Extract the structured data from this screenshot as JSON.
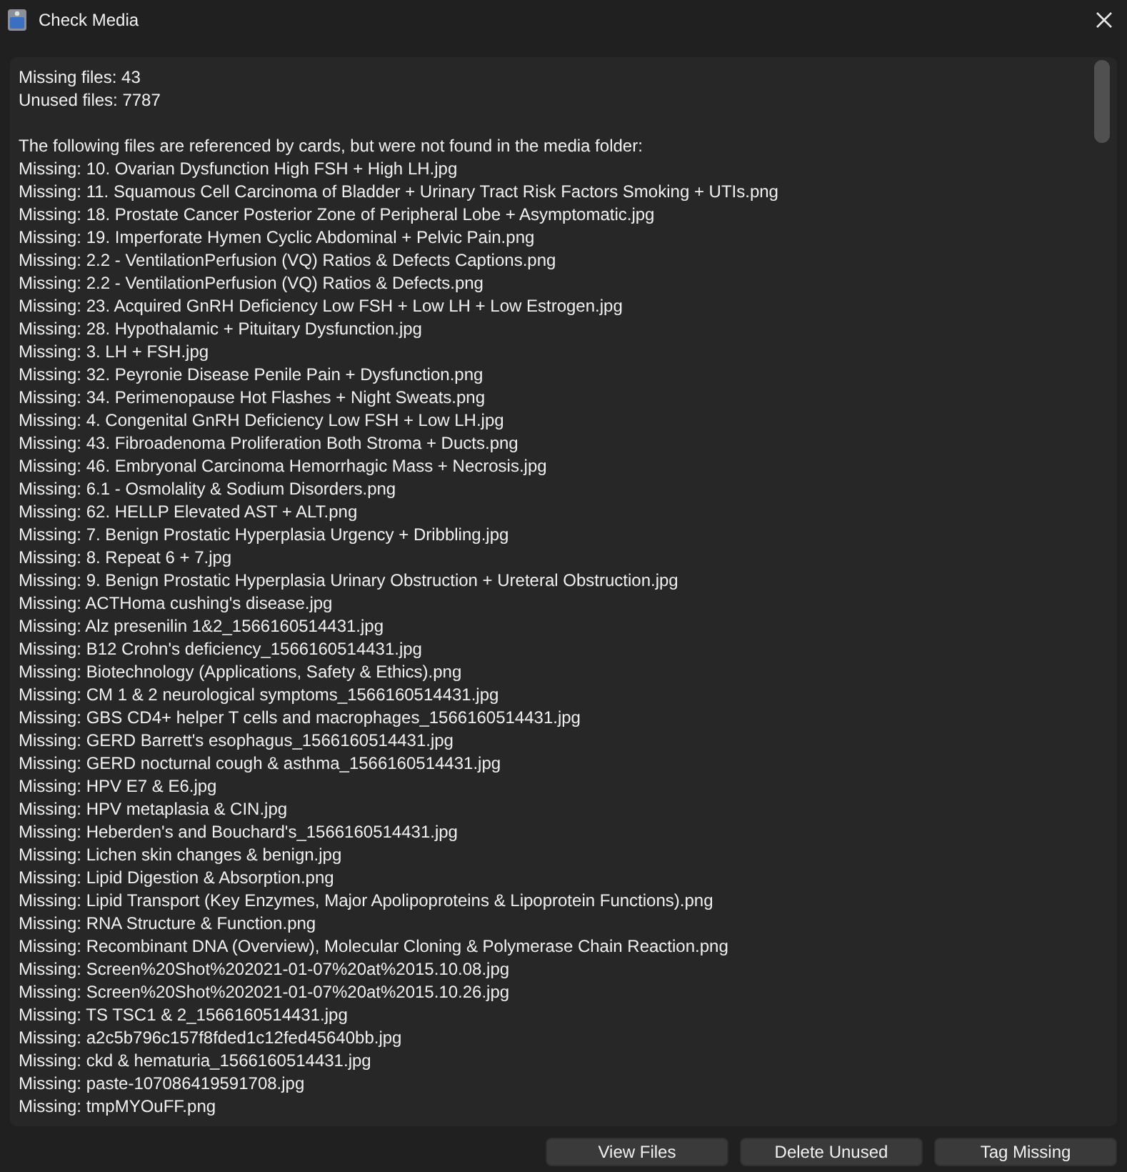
{
  "window": {
    "title": "Check Media"
  },
  "report": {
    "summary": [
      "Missing files: 43",
      "Unused files: 7787"
    ],
    "heading": "The following files are referenced by cards, but were not found in the media folder:",
    "missing": [
      "Missing: 10. Ovarian Dysfunction High FSH + High LH.jpg",
      "Missing: 11. Squamous Cell Carcinoma of Bladder + Urinary Tract Risk Factors Smoking + UTIs.png",
      "Missing: 18. Prostate Cancer Posterior Zone of Peripheral Lobe + Asymptomatic.jpg",
      "Missing: 19. Imperforate Hymen Cyclic Abdominal + Pelvic Pain.png",
      "Missing: 2.2 - VentilationPerfusion (VQ) Ratios & Defects Captions.png",
      "Missing: 2.2 - VentilationPerfusion (VQ) Ratios & Defects.png",
      "Missing: 23. Acquired GnRH Deficiency Low FSH + Low LH + Low Estrogen.jpg",
      "Missing: 28. Hypothalamic + Pituitary Dysfunction.jpg",
      "Missing: 3. LH + FSH.jpg",
      "Missing: 32. Peyronie Disease Penile Pain + Dysfunction.png",
      "Missing: 34. Perimenopause Hot Flashes + Night Sweats.png",
      "Missing: 4. Congenital GnRH Deficiency Low FSH + Low LH.jpg",
      "Missing: 43. Fibroadenoma Proliferation Both Stroma + Ducts.png",
      "Missing: 46. Embryonal Carcinoma Hemorrhagic Mass + Necrosis.jpg",
      "Missing: 6.1 - Osmolality & Sodium Disorders.png",
      "Missing: 62. HELLP Elevated AST + ALT.png",
      "Missing: 7. Benign Prostatic Hyperplasia Urgency + Dribbling.jpg",
      "Missing: 8. Repeat 6 + 7.jpg",
      "Missing: 9. Benign Prostatic Hyperplasia Urinary Obstruction + Ureteral Obstruction.jpg",
      "Missing: ACTHoma cushing's disease.jpg",
      "Missing: Alz presenilin 1&2_1566160514431.jpg",
      "Missing: B12 Crohn's deficiency_1566160514431.jpg",
      "Missing: Biotechnology (Applications, Safety & Ethics).png",
      "Missing: CM 1 & 2 neurological symptoms_1566160514431.jpg",
      "Missing: GBS CD4+ helper T cells and macrophages_1566160514431.jpg",
      "Missing: GERD Barrett's esophagus_1566160514431.jpg",
      "Missing: GERD nocturnal cough & asthma_1566160514431.jpg",
      "Missing: HPV E7 & E6.jpg",
      "Missing: HPV metaplasia & CIN.jpg",
      "Missing: Heberden's and Bouchard's_1566160514431.jpg",
      "Missing: Lichen skin changes & benign.jpg",
      "Missing: Lipid Digestion & Absorption.png",
      "Missing: Lipid Transport (Key Enzymes, Major Apolipoproteins & Lipoprotein Functions).png",
      "Missing: RNA Structure & Function.png",
      "Missing: Recombinant DNA (Overview), Molecular Cloning & Polymerase Chain Reaction.png",
      "Missing: Screen%20Shot%202021-01-07%20at%2015.10.08.jpg",
      "Missing: Screen%20Shot%202021-01-07%20at%2015.10.26.jpg",
      "Missing: TS TSC1 & 2_1566160514431.jpg",
      "Missing: a2c5b796c157f8fded1c12fed45640bb.jpg",
      "Missing: ckd & hematuria_1566160514431.jpg",
      "Missing: paste-107086419591708.jpg",
      "Missing: tmpMYOuFF.png"
    ]
  },
  "buttons": [
    "View Files",
    "Delete Unused",
    "Tag Missing"
  ]
}
